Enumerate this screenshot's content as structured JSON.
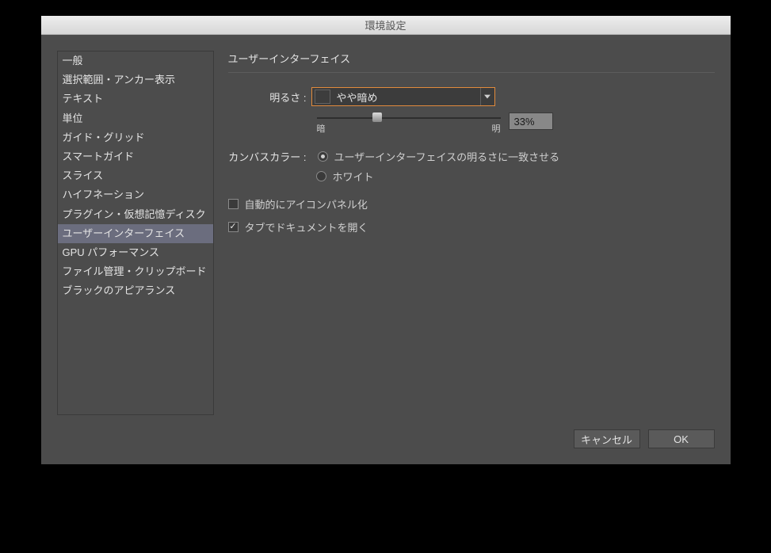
{
  "title": "環境設定",
  "sidebar": {
    "items": [
      {
        "label": "一般"
      },
      {
        "label": "選択範囲・アンカー表示"
      },
      {
        "label": "テキスト"
      },
      {
        "label": "単位"
      },
      {
        "label": "ガイド・グリッド"
      },
      {
        "label": "スマートガイド"
      },
      {
        "label": "スライス"
      },
      {
        "label": "ハイフネーション"
      },
      {
        "label": "プラグイン・仮想記憶ディスク"
      },
      {
        "label": "ユーザーインターフェイス",
        "selected": true
      },
      {
        "label": "GPU パフォーマンス"
      },
      {
        "label": "ファイル管理・クリップボード"
      },
      {
        "label": "ブラックのアピアランス"
      }
    ]
  },
  "panel": {
    "heading": "ユーザーインターフェイス",
    "brightness": {
      "label": "明るさ :",
      "value": "やや暗め",
      "slider_dark": "暗",
      "slider_light": "明",
      "percent": "33%"
    },
    "canvas": {
      "label": "カンバスカラー :",
      "options": [
        {
          "label": "ユーザーインターフェイスの明るさに一致させる",
          "checked": true
        },
        {
          "label": "ホワイト",
          "checked": false
        }
      ]
    },
    "auto_collapse": {
      "label": "自動的にアイコンパネル化",
      "checked": false
    },
    "open_tabs": {
      "label": "タブでドキュメントを開く",
      "checked": true
    }
  },
  "buttons": {
    "cancel": "キャンセル",
    "ok": "OK"
  }
}
